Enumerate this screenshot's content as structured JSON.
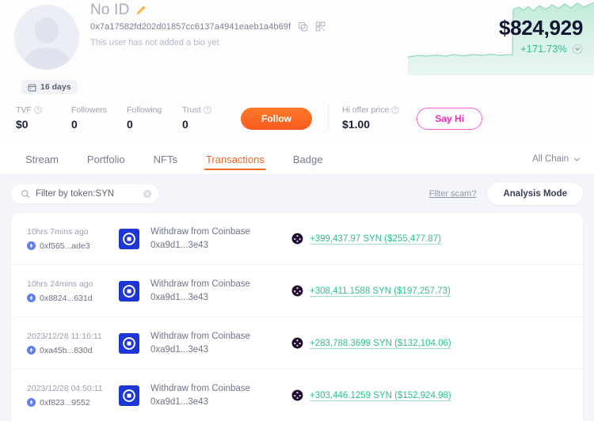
{
  "profile": {
    "display_name": "No ID",
    "edit_icon": "pencil-icon",
    "address": "0x7a17582fd202d01857cc6137a4941eaeb1a4b69f",
    "copy_icon": "copy-icon",
    "qr_icon": "qr-code-icon",
    "bio": "This user has not added a bio yet",
    "age_badge": "16 days",
    "age_badge_icon": "calendar-icon",
    "avatar_icon": "avatar-placeholder-icon"
  },
  "portfolio": {
    "value": "$824,929",
    "change": "+171.73%",
    "change_color": "#2ec08a",
    "expand_icon": "chevron-down-circle-icon"
  },
  "stats": [
    {
      "label": "TVF",
      "value": "$0",
      "has_info": true
    },
    {
      "label": "Followers",
      "value": "0",
      "has_info": false
    },
    {
      "label": "Following",
      "value": "0",
      "has_info": false
    },
    {
      "label": "Trust",
      "value": "0",
      "has_info": true
    }
  ],
  "actions": {
    "follow_label": "Follow",
    "follow_color": "#f9591c",
    "hi_price_label": "Hi offer price",
    "hi_price_value": "$1.00",
    "say_hi_label": "Say Hi",
    "say_hi_color": "#f724b8"
  },
  "tabs": [
    {
      "label": "Stream",
      "active": false
    },
    {
      "label": "Portfolio",
      "active": false
    },
    {
      "label": "NFTs",
      "active": false
    },
    {
      "label": "Transactions",
      "active": true
    },
    {
      "label": "Badge",
      "active": false
    }
  ],
  "tab_accent": "#f3682a",
  "chain_filter": {
    "label": "All Chain",
    "icon": "chevron-down-icon"
  },
  "search": {
    "value": "Filter by token:SYN",
    "placeholder": "Filter by token",
    "icon": "search-icon",
    "clear_icon": "close-circle-icon"
  },
  "toolbar": {
    "scam_link": "Filter scam?",
    "analysis_label": "Analysis Mode"
  },
  "transactions": [
    {
      "time": "10hrs 7mins ago",
      "hash": "0xf565...ade3",
      "chain_icon": "ethereum-icon",
      "platform_icon": "coinbase-icon",
      "description": "Withdraw from Coinbase",
      "to_address": "0xa9d1...3e43",
      "token_icon": "syn-token-icon",
      "amount": "+399,437.97 SYN ($255,477.87)"
    },
    {
      "time": "10hrs 24mins ago",
      "hash": "0x8824...631d",
      "chain_icon": "ethereum-icon",
      "platform_icon": "coinbase-icon",
      "description": "Withdraw from Coinbase",
      "to_address": "0xa9d1...3e43",
      "token_icon": "syn-token-icon",
      "amount": "+308,411.1588 SYN ($197,257.73)"
    },
    {
      "time": "2023/12/28 11:16:11",
      "hash": "0xa45b...830d",
      "chain_icon": "ethereum-icon",
      "platform_icon": "coinbase-icon",
      "description": "Withdraw from Coinbase",
      "to_address": "0xa9d1...3e43",
      "token_icon": "syn-token-icon",
      "amount": "+283,788.3699 SYN ($132,104.06)"
    },
    {
      "time": "2023/12/28 04:50:11",
      "hash": "0xf823...9552",
      "chain_icon": "ethereum-icon",
      "platform_icon": "coinbase-icon",
      "description": "Withdraw from Coinbase",
      "to_address": "0xa9d1...3e43",
      "token_icon": "syn-token-icon",
      "amount": "+303,446.1259 SYN ($152,924.98)"
    }
  ]
}
